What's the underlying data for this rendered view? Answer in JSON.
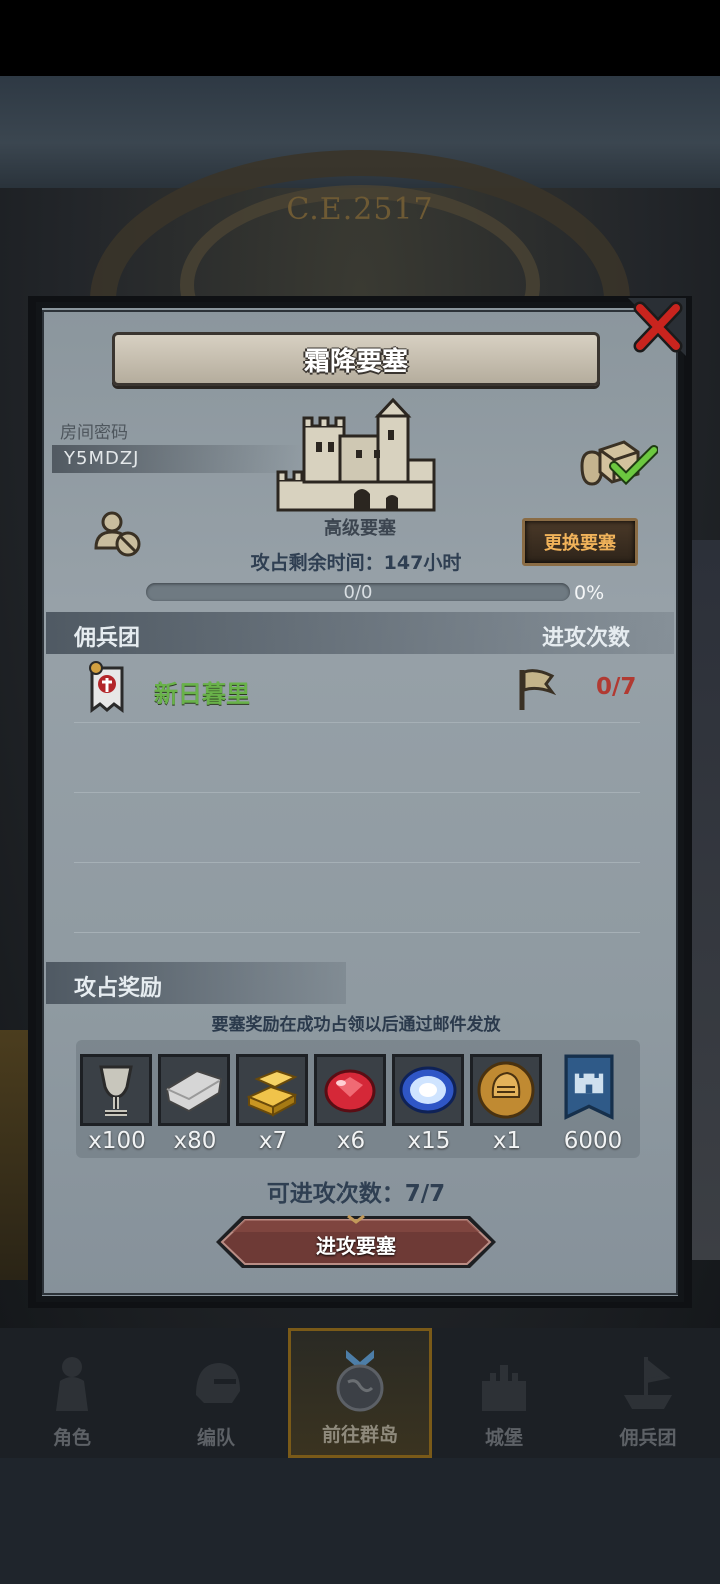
{
  "background": {
    "year": "C.E.2517"
  },
  "dialog": {
    "title": "霜降要塞",
    "room": {
      "label": "房间密码",
      "code": "Y5MDZJ"
    },
    "fortress_type": "高级要塞",
    "change_button": "更换要塞",
    "remaining_time": "攻占剩余时间：147小时",
    "progress": {
      "text": "0/0",
      "percent_text": "0%",
      "fraction": 0
    },
    "mercenary": {
      "header": "佣兵团",
      "column": "进攻次数",
      "rows": [
        {
          "name": "新日暮里",
          "attacks": "0/7"
        }
      ]
    },
    "rewards": {
      "header": "攻占奖励",
      "note": "要塞奖励在成功占领以后通过邮件发放",
      "items": [
        {
          "icon": "goblet-icon",
          "qty": "x100"
        },
        {
          "icon": "stone-icon",
          "qty": "x80"
        },
        {
          "icon": "gold-bar-icon",
          "qty": "x7"
        },
        {
          "icon": "ruby-icon",
          "qty": "x6"
        },
        {
          "icon": "crystal-icon",
          "qty": "x15"
        },
        {
          "icon": "helmet-coin-icon",
          "qty": "x1"
        },
        {
          "icon": "banner-emblem-icon",
          "qty": "6000"
        }
      ]
    },
    "attacks_left": "可进攻次数：7/7",
    "attack_button": "进攻要塞"
  },
  "nav": [
    {
      "label": "角色",
      "icon": "knight-icon"
    },
    {
      "label": "编队",
      "icon": "helmet-icon"
    },
    {
      "label": "前往群岛",
      "icon": "globe-icon",
      "active": true
    },
    {
      "label": "城堡",
      "icon": "castle-icon"
    },
    {
      "label": "佣兵团",
      "icon": "ship-icon"
    }
  ],
  "colors": {
    "accent_gold": "#f0b25a",
    "guild_green": "#69b24a",
    "attack_red": "#b13a32"
  }
}
